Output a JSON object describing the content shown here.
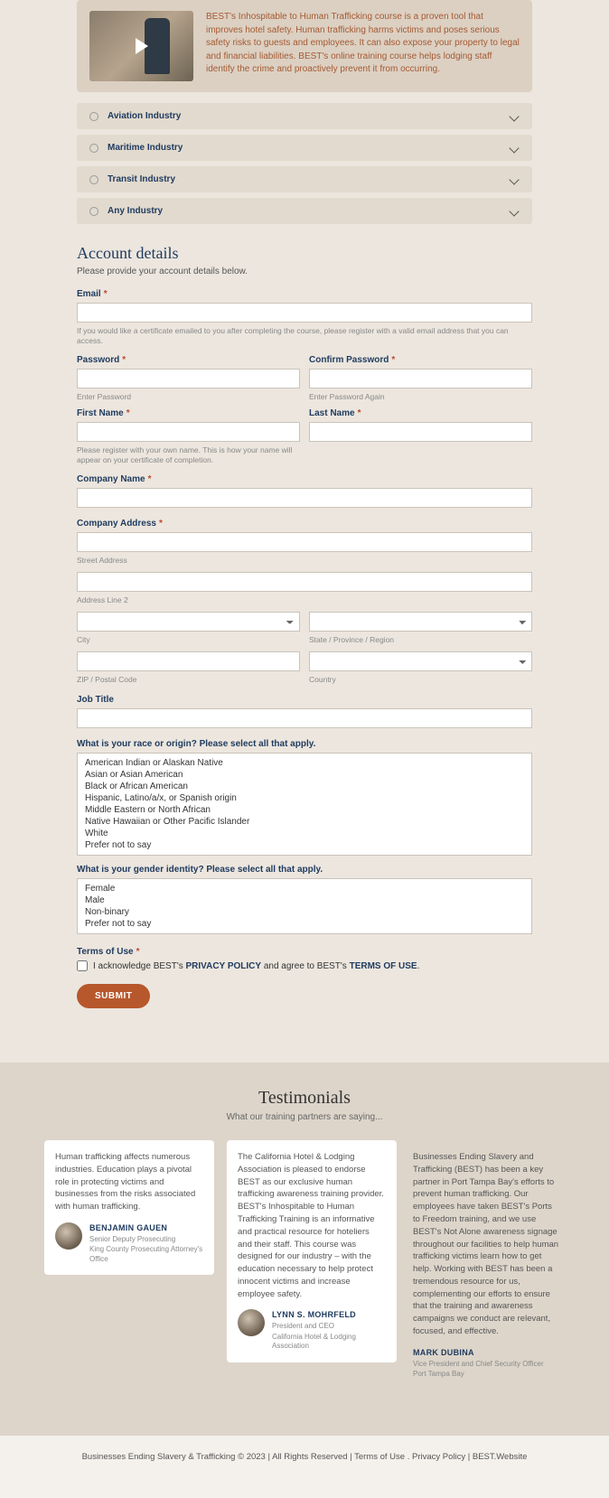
{
  "hero": {
    "description": "BEST's Inhospitable to Human Trafficking course is a proven tool that improves hotel safety. Human trafficking harms victims and poses serious safety risks to guests and employees. It can also expose your property to legal and financial liabilities. BEST's online training course helps lodging staff identify the crime and proactively prevent it from occurring."
  },
  "accordion": [
    {
      "label": "Aviation Industry"
    },
    {
      "label": "Maritime Industry"
    },
    {
      "label": "Transit Industry"
    },
    {
      "label": "Any Industry"
    }
  ],
  "form": {
    "section_title": "Account details",
    "section_sub": "Please provide your account details below.",
    "email_label": "Email",
    "email_hint": "If you would like a certificate emailed to you after completing the course, please register with a valid email address that you can access.",
    "password_label": "Password",
    "password_hint": "Enter Password",
    "confirm_label": "Confirm Password",
    "confirm_hint": "Enter Password Again",
    "first_name_label": "First Name",
    "first_name_hint": "Please register with your own name. This is how your name will appear on your certificate of completion.",
    "last_name_label": "Last Name",
    "company_name_label": "Company Name",
    "company_address_label": "Company Address",
    "addr_street_sub": "Street Address",
    "addr_line2_sub": "Address Line 2",
    "city_sub": "City",
    "state_sub": "State / Province / Region",
    "zip_sub": "ZIP / Postal Code",
    "country_sub": "Country",
    "job_title_label": "Job Title",
    "race_label": "What is your race or origin? Please select all that apply.",
    "race_options": [
      "American Indian or Alaskan Native",
      "Asian or Asian American",
      "Black or African American",
      "Hispanic, Latino/a/x, or Spanish origin",
      "Middle Eastern or North African",
      "Native Hawaiian or Other Pacific Islander",
      "White",
      "Prefer not to say"
    ],
    "gender_label": "What is your gender identity? Please select all that apply.",
    "gender_options": [
      "Female",
      "Male",
      "Non-binary",
      "Prefer not to say"
    ],
    "terms_label": "Terms of Use",
    "terms_ack_pre": "I acknowledge BEST's ",
    "terms_priv": "PRIVACY POLICY",
    "terms_mid": " and agree to BEST's ",
    "terms_tou": "TERMS OF USE",
    "terms_post": ".",
    "submit": "SUBMIT"
  },
  "testimonials": {
    "title": "Testimonials",
    "sub": "What our training partners are saying...",
    "items": [
      {
        "quote": "Human trafficking affects numerous industries. Education plays a pivotal role in protecting victims and businesses from the risks associated with human trafficking.",
        "name": "BENJAMIN GAUEN",
        "role1": "Senior Deputy Prosecuting",
        "role2": "King County Prosecuting Attorney's Office",
        "hasAvatar": true,
        "bg": true
      },
      {
        "quote": "The California Hotel & Lodging Association is pleased to endorse BEST as our exclusive human trafficking awareness training provider. BEST's Inhospitable to Human Trafficking Training is an informative and practical resource for hoteliers and their staff. This course was designed for our industry – with the education necessary to help protect innocent victims and increase employee safety.",
        "name": "LYNN S. MOHRFELD",
        "role1": "President and CEO",
        "role2": "California Hotel & Lodging Association",
        "hasAvatar": true,
        "bg": true
      },
      {
        "quote": "Businesses Ending Slavery and Trafficking (BEST) has been a key partner in Port Tampa Bay's efforts to prevent human trafficking. Our employees have taken BEST's Ports to Freedom training, and we use BEST's Not Alone awareness signage throughout our facilities to help human trafficking victims learn how to get help. Working with BEST has been a tremendous resource for us, complementing our efforts to ensure that the training and awareness campaigns we conduct are relevant, focused, and effective.",
        "name": "MARK DUBINA",
        "role1": "Vice President and Chief Security Officer",
        "role2": "Port Tampa Bay",
        "hasAvatar": false,
        "bg": false
      }
    ]
  },
  "footer": {
    "copyright": "Businesses Ending Slavery & Trafficking © 2023",
    "sep": " | ",
    "rights": "All Rights Reserved",
    "terms": "Terms of Use",
    "dot": " . ",
    "privacy": "Privacy Policy",
    "site": "BEST.Website"
  }
}
